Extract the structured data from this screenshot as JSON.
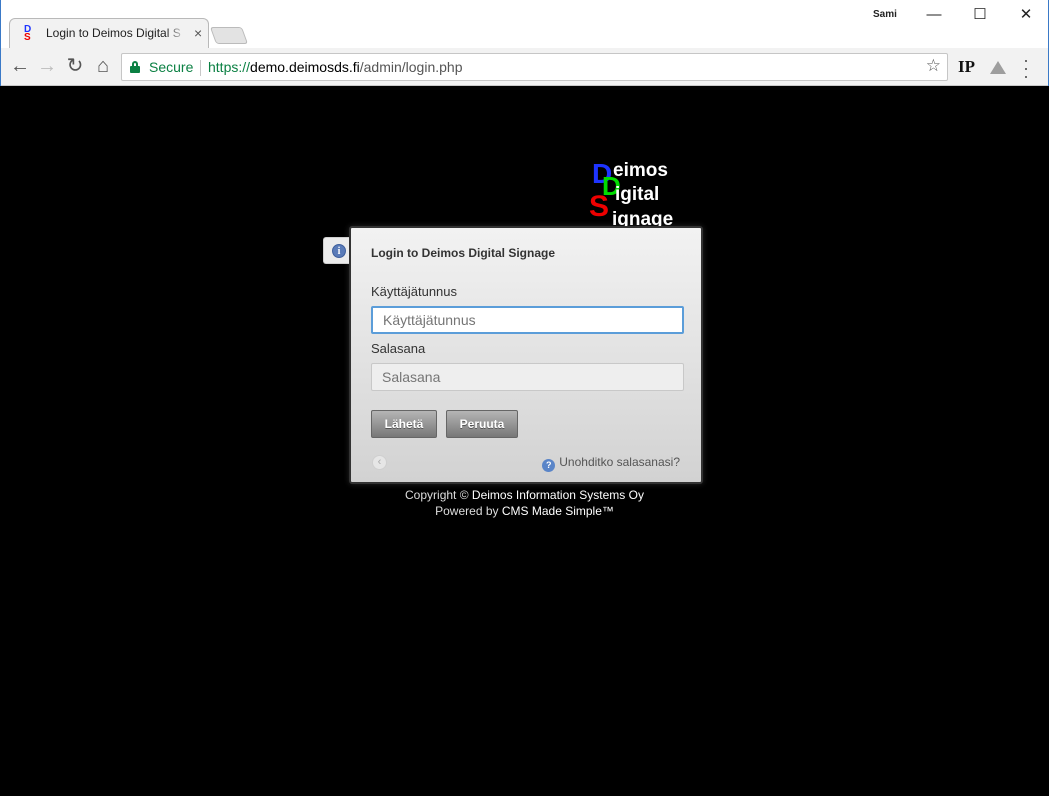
{
  "browser": {
    "tab_title": "Login to Deimos Digital S",
    "profile_name": "Sami",
    "secure_label": "Secure",
    "url_scheme": "https://",
    "url_host": "demo.deimosds.fi",
    "url_path": "/admin/login.php",
    "extension_ip_label": "IP"
  },
  "logo": {
    "letters": [
      "D",
      "D",
      "S"
    ],
    "words": [
      "eimos",
      "igital",
      "ignage"
    ],
    "colors": {
      "d1": "#1e34ff",
      "d2": "#00dd00",
      "s": "#ee0000"
    }
  },
  "login": {
    "title": "Login to Deimos Digital Signage",
    "username_label": "Käyttäjätunnus",
    "username_placeholder": "Käyttäjätunnus",
    "password_label": "Salasana",
    "password_placeholder": "Salasana",
    "submit_label": "Lähetä",
    "cancel_label": "Peruuta",
    "forgot_label": "Unohditko salasanasi?"
  },
  "footer": {
    "copyright_prefix": "Copyright ©",
    "copyright_company": "Deimos Information Systems Oy",
    "powered_prefix": "Powered by",
    "powered_product": "CMS Made Simple™"
  }
}
